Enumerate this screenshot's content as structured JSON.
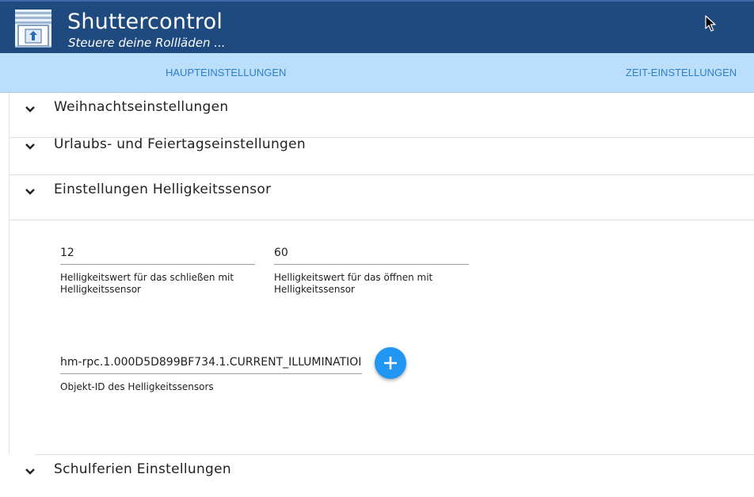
{
  "header": {
    "title": "Shuttercontrol",
    "subtitle": "Steuere deine Rollläden ...",
    "logo_icon": "shutter-logo-icon",
    "brand_color": "#1f4a7f"
  },
  "tabs": [
    {
      "label": "HAUPTEINSTELLUNGEN"
    },
    {
      "label": "ZEIT-EINSTELLUNGEN"
    }
  ],
  "panels": [
    {
      "title": "Weihnachtseinstellungen",
      "icon": "chevron-down-icon"
    },
    {
      "title": "Urlaubs- und Feiertagseinstellungen",
      "icon": "chevron-down-icon"
    },
    {
      "title": "Einstellungen Helligkeitssensor",
      "icon": "chevron-down-icon"
    },
    {
      "title": "Schulferien Einstellungen",
      "icon": "chevron-down-icon"
    }
  ],
  "brightness": {
    "close_value": "12",
    "close_label": "Helligkeitswert für das schließen mit Helligkeitssensor",
    "open_value": "60",
    "open_label": "Helligkeitswert für das öffnen mit Helligkeitssensor",
    "object_id_value": "hm-rpc.1.000D5D899BF734.1.CURRENT_ILLUMINATIOI",
    "object_id_label": "Objekt-ID des Helligkeitssensors",
    "add_icon": "plus-icon",
    "accent_color": "#2196f3"
  }
}
